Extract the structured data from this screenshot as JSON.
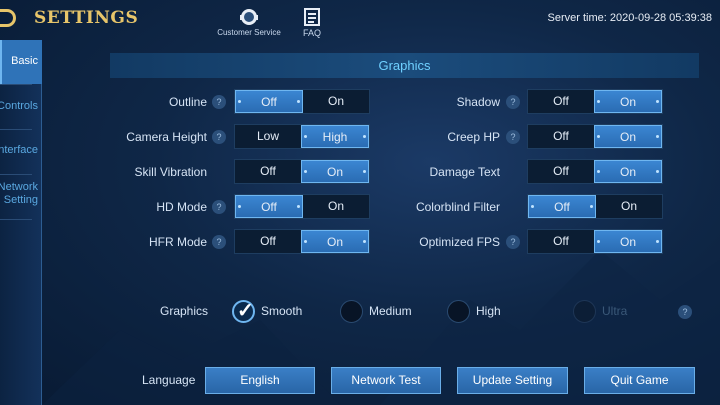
{
  "header": {
    "title": "SETTINGS",
    "customer_service_label": "Customer Service",
    "faq_label": "FAQ",
    "server_time": "Server time: 2020-09-28 05:39:38"
  },
  "sidebar": {
    "items": [
      {
        "label": "Basic",
        "active": true
      },
      {
        "label": "Controls",
        "active": false
      },
      {
        "label": "Interface",
        "active": false
      },
      {
        "label": "Network",
        "label2": "Setting",
        "active": false
      }
    ]
  },
  "section": {
    "title": "Graphics"
  },
  "left_rows": [
    {
      "label": "Outline",
      "off": "Off",
      "on": "On",
      "value": "Off"
    },
    {
      "label": "Camera Height",
      "off": "Low",
      "on": "High",
      "value": "High"
    },
    {
      "label": "Skill Vibration",
      "off": "Off",
      "on": "On",
      "value": "On"
    },
    {
      "label": "HD Mode",
      "off": "Off",
      "on": "On",
      "value": "Off"
    },
    {
      "label": "HFR Mode",
      "off": "Off",
      "on": "On",
      "value": "On"
    }
  ],
  "right_rows": [
    {
      "label": "Shadow",
      "off": "Off",
      "on": "On",
      "value": "On"
    },
    {
      "label": "Creep HP",
      "off": "Off",
      "on": "On",
      "value": "On"
    },
    {
      "label": "Damage Text",
      "off": "Off",
      "on": "On",
      "value": "On"
    },
    {
      "label": "Colorblind Filter",
      "off": "Off",
      "on": "On",
      "value": "Off"
    },
    {
      "label": "Optimized FPS",
      "off": "Off",
      "on": "On",
      "value": "On"
    }
  ],
  "help_glyph": "?",
  "graphics_quality": {
    "label": "Graphics",
    "options": [
      "Smooth",
      "Medium",
      "High",
      "Ultra"
    ],
    "selected": "Smooth",
    "disabled": [
      "Ultra"
    ]
  },
  "bottom": {
    "language_label": "Language",
    "language_value": "English",
    "network_test": "Network Test",
    "update_setting": "Update Setting",
    "quit_game": "Quit Game"
  },
  "colors": {
    "accent": "#3b86d2",
    "title_gold": "#e7c56a",
    "section_text": "#6fd0ff"
  }
}
